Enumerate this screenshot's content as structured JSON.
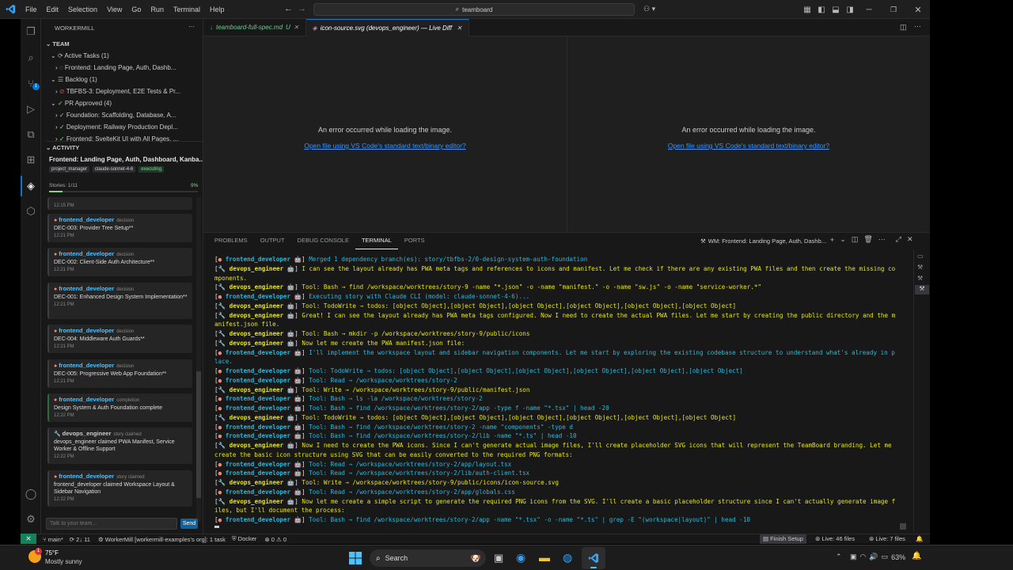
{
  "titlebar": {
    "menu": [
      "File",
      "Edit",
      "Selection",
      "View",
      "Go",
      "Run",
      "Terminal",
      "Help"
    ],
    "search_text": "teamboard"
  },
  "sidebar": {
    "title": "WORKERMILL",
    "team_header": "TEAM",
    "active_tasks": "Active Tasks (1)",
    "active_items": [
      "Frontend: Landing Page, Auth, Dashb..."
    ],
    "backlog": "Backlog (1)",
    "backlog_items": [
      "TBFBS-3: Deployment, E2E Tests & Pr..."
    ],
    "pr_approved": "PR Approved (4)",
    "pr_items": [
      "Foundation: Scaffolding, Database, A...",
      "Deployment: Railway Production Depl...",
      "Frontend: SvelteKit UI with All Pages, ..."
    ],
    "activity_header": "ACTIVITY",
    "activity_title": "Frontend: Landing Page, Auth, Dashboard, Kanba...",
    "tags": [
      "project_manager",
      "claude-sonnet-4-6",
      "executing"
    ],
    "stories": "Stories: 1/11",
    "stories_pct": "9%",
    "progress_fraction": 0.09,
    "top_time": "12:15 PM",
    "cards": [
      {
        "agent": "frontend_developer",
        "kind": "decision",
        "body": "DEC-003: Provider Tree Setup**",
        "time": "12:21 PM"
      },
      {
        "agent": "frontend_developer",
        "kind": "decision",
        "body": "DEC-002: Client-Side Auth Architecture**",
        "time": "12:21 PM"
      },
      {
        "agent": "frontend_developer",
        "kind": "decision",
        "body": "DEC-001: Enhanced Design System Implementation**",
        "time": "12:21 PM"
      },
      {
        "agent": "frontend_developer",
        "kind": "decision",
        "body": "DEC-004: Middleware Auth Guards**",
        "time": "12:21 PM"
      },
      {
        "agent": "frontend_developer",
        "kind": "decision",
        "body": "DEC-005: Progressive Web App Foundation**",
        "time": "12:21 PM"
      },
      {
        "agent": "frontend_developer",
        "kind": "completion",
        "body": "Design System & Auth Foundation complete",
        "time": "12:22 PM"
      },
      {
        "agent": "devops_engineer",
        "kind": "story claimed",
        "body": "devops_engineer claimed PWA Manifest, Service Worker & Offline Support",
        "time": "12:22 PM"
      },
      {
        "agent": "frontend_developer",
        "kind": "story claimed",
        "body": "frontend_developer claimed Workspace Layout & Sidebar Navigation",
        "time": "12:22 PM"
      }
    ],
    "chat_placeholder": "Talk to your team...",
    "send_label": "Send"
  },
  "editor": {
    "tabs": [
      {
        "label": "teamboard-full-spec.md",
        "badge": "U"
      },
      {
        "label": "icon-source.svg (devops_engineer) — Live Diff",
        "badge": ""
      }
    ],
    "error_text": "An error occurred while loading the image.",
    "open_link": "Open file using VS Code's standard text/binary editor?"
  },
  "panel": {
    "tabs": [
      "PROBLEMS",
      "OUTPUT",
      "DEBUG CONSOLE",
      "TERMINAL",
      "PORTS"
    ],
    "terminal_name": "WM: Frontend: Landing Page, Auth, Dashb...",
    "lines": [
      {
        "a": "fe",
        "t": "Merged 1 dependency branch(es): story/tbfbs-2/0-design-system-auth-foundation"
      },
      {
        "a": "do",
        "t": "I can see the layout already has PWA meta tags and references to icons and manifest. Let me check if there are any existing PWA files and then create the missing components."
      },
      {
        "a": "do",
        "t": "Tool: Bash → find /workspace/worktrees/story-9 -name \"*.json\" -o -name \"manifest.\" -o -name \"sw.js\" -o -name \"service-worker.*\""
      },
      {
        "a": "fe",
        "t": "Executing story with Claude CLI (model: claude-sonnet-4-6)..."
      },
      {
        "a": "do",
        "t": "Tool: TodoWrite → todos: [object Object],[object Object],[object Object],[object Object],[object Object],[object Object]"
      },
      {
        "a": "do",
        "t": "Great! I can see the layout already has PWA meta tags configured. Now I need to create the actual PWA files. Let me start by creating the public directory and the manifest.json file."
      },
      {
        "a": "do",
        "t": "Tool: Bash → mkdir -p /workspace/worktrees/story-9/public/icons"
      },
      {
        "a": "do",
        "t": "Now let me create the PWA manifest.json file:"
      },
      {
        "a": "fe",
        "t": "I'll implement the workspace layout and sidebar navigation components. Let me start by exploring the existing codebase structure to understand what's already in place."
      },
      {
        "a": "fe",
        "t": "Tool: TodoWrite → todos: [object Object],[object Object],[object Object],[object Object],[object Object],[object Object]"
      },
      {
        "a": "fe",
        "t": "Tool: Read → /workspace/worktrees/story-2"
      },
      {
        "a": "do",
        "t": "Tool: Write → /workspace/worktrees/story-9/public/manifest.json"
      },
      {
        "a": "fe",
        "t": "Tool: Bash → ls -la /workspace/worktrees/story-2"
      },
      {
        "a": "fe",
        "t": "Tool: Bash → find /workspace/worktrees/story-2/app -type f -name \"*.tsx\" | head -20"
      },
      {
        "a": "do",
        "t": "Tool: TodoWrite → todos: [object Object],[object Object],[object Object],[object Object],[object Object],[object Object]"
      },
      {
        "a": "fe",
        "t": "Tool: Bash → find /workspace/worktrees/story-2 -name \"components\" -type d"
      },
      {
        "a": "fe",
        "t": "Tool: Bash → find /workspace/worktrees/story-2/lib -name \"*.ts\" | head -10"
      },
      {
        "a": "do",
        "t": "Now I need to create the PWA icons. Since I can't generate actual image files, I'll create placeholder SVG icons that will represent the TeamBoard branding. Let me create the basic icon structure using SVG that can be easily converted to the required PNG formats:"
      },
      {
        "a": "fe",
        "t": "Tool: Read → /workspace/worktrees/story-2/app/layout.tsx"
      },
      {
        "a": "fe",
        "t": "Tool: Read → /workspace/worktrees/story-2/lib/auth-client.tsx"
      },
      {
        "a": "do",
        "t": "Tool: Write → /workspace/worktrees/story-9/public/icons/icon-source.svg"
      },
      {
        "a": "fe",
        "t": "Tool: Read → /workspace/worktrees/story-2/app/globals.css"
      },
      {
        "a": "do",
        "t": "Now let me create a simple script to generate the required PNG icons from the SVG. I'll create a basic placeholder structure since I can't actually generate image files, but I'll document the process:"
      },
      {
        "a": "fe",
        "t": "Tool: Bash → find /workspace/worktrees/story-2/app -name \"*.tsx\" -o -name \"*.ts\" | grep -E \"(workspace|layout)\" | head -10"
      }
    ],
    "agents": {
      "fe": "frontend_developer",
      "do": "devops_engineer"
    }
  },
  "statusbar": {
    "branch": "main*",
    "sync": "2↓ 11",
    "workermill": "WorkerMill [workermill-examples's org]: 1 task",
    "docker": "Docker",
    "problems": "⊗ 0 ⚠ 0",
    "finish_setup": "Finish Setup",
    "live_files": "Live: 46 files",
    "live_files2": "Live: 7 files"
  },
  "taskbar": {
    "temp": "75°F",
    "weather": "Mostly sunny",
    "search": "Search",
    "battery": "63%",
    "weather_badge": "1"
  }
}
